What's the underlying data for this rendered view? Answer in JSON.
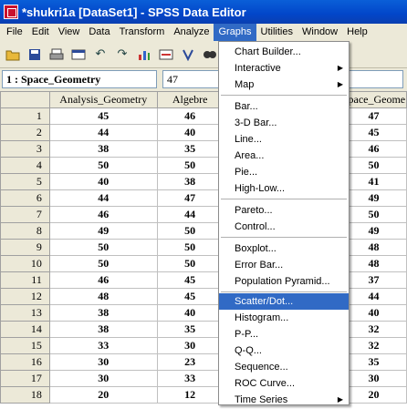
{
  "window": {
    "title": "*shukri1a [DataSet1] - SPSS Data Editor"
  },
  "menubar": [
    "File",
    "Edit",
    "View",
    "Data",
    "Transform",
    "Analyze",
    "Graphs",
    "Utilities",
    "Window",
    "Help"
  ],
  "cell": {
    "ref": "1 : Space_Geometry",
    "value": "47"
  },
  "columns": {
    "c1": "Analysis_Geometry",
    "c2": "Algebre",
    "c3": "Space_Geome"
  },
  "rows": [
    {
      "n": "1",
      "a": "45",
      "b": "46",
      "c": "47"
    },
    {
      "n": "2",
      "a": "44",
      "b": "40",
      "c": "45"
    },
    {
      "n": "3",
      "a": "38",
      "b": "35",
      "c": "46"
    },
    {
      "n": "4",
      "a": "50",
      "b": "50",
      "c": "50"
    },
    {
      "n": "5",
      "a": "40",
      "b": "38",
      "c": "41"
    },
    {
      "n": "6",
      "a": "44",
      "b": "47",
      "c": "49"
    },
    {
      "n": "7",
      "a": "46",
      "b": "44",
      "c": "50"
    },
    {
      "n": "8",
      "a": "49",
      "b": "50",
      "c": "49"
    },
    {
      "n": "9",
      "a": "50",
      "b": "50",
      "c": "48"
    },
    {
      "n": "10",
      "a": "50",
      "b": "50",
      "c": "48"
    },
    {
      "n": "11",
      "a": "46",
      "b": "45",
      "c": "37"
    },
    {
      "n": "12",
      "a": "48",
      "b": "45",
      "c": "44"
    },
    {
      "n": "13",
      "a": "38",
      "b": "40",
      "c": "40"
    },
    {
      "n": "14",
      "a": "38",
      "b": "35",
      "c": "32"
    },
    {
      "n": "15",
      "a": "33",
      "b": "30",
      "c": "32"
    },
    {
      "n": "16",
      "a": "30",
      "b": "23",
      "c": "35"
    },
    {
      "n": "17",
      "a": "30",
      "b": "33",
      "c": "30"
    },
    {
      "n": "18",
      "a": "20",
      "b": "12",
      "c": "20"
    }
  ],
  "graphs_menu": [
    "Chart Builder...",
    "Interactive",
    "Map",
    "Bar...",
    "3-D Bar...",
    "Line...",
    "Area...",
    "Pie...",
    "High-Low...",
    "Pareto...",
    "Control...",
    "Boxplot...",
    "Error Bar...",
    "Population Pyramid...",
    "Scatter/Dot...",
    "Histogram...",
    "P-P...",
    "Q-Q...",
    "Sequence...",
    "ROC Curve...",
    "Time Series"
  ],
  "icons": [
    "open-folder-icon",
    "save-icon",
    "print-icon",
    "dialog-recall-icon",
    "undo-icon",
    "redo-icon",
    "goto-chart-icon",
    "goto-case-icon",
    "variables-icon",
    "find-icon",
    "insert-cases-icon",
    "value-labels-icon",
    "use-sets-icon"
  ]
}
